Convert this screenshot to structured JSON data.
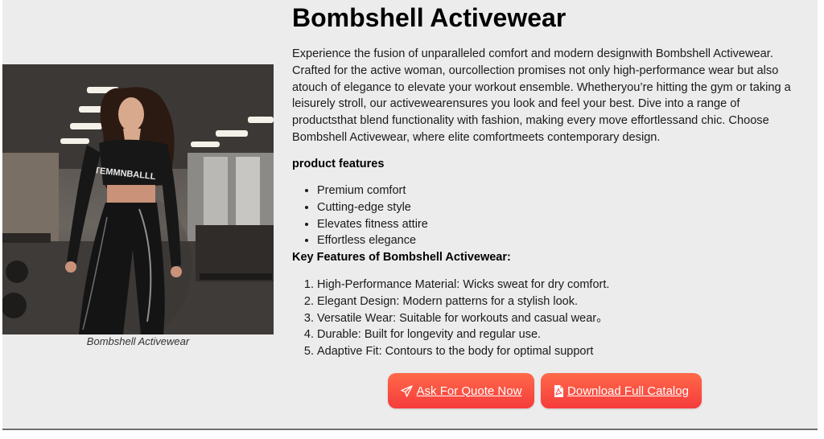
{
  "product": {
    "title": "Bombshell Activewear",
    "description": "Experience the fusion of unparalleled comfort and modern designwith Bombshell Activewear. Crafted for the active woman, ourcollection promises not only high-performance wear but also atouch of elegance to elevate your workout ensemble. Whetheryou’re hitting the gym or taking a leisurely stroll, our activewearensures you look and feel your best. Dive into a range of productsthat blend functionality with fashion, making every move effortlessand chic. Choose Bombshell Activewear, where elite comfortmeets contemporary design.",
    "image_caption": "Bombshell Activewear",
    "shirt_print": "TEMMNBALLL"
  },
  "features": {
    "heading": "product features",
    "items": [
      "Premium comfort",
      "Cutting-edge style",
      "Elevates fitness attire",
      "Effortless elegance"
    ]
  },
  "key_features": {
    "heading": "Key Features of Bombshell Activewear:",
    "items": [
      "High-Performance Material: Wicks sweat for dry comfort.",
      " Elegant Design: Modern patterns for a stylish look.",
      " Versatile Wear: Suitable for workouts and casual wear。",
      "Durable: Built for longevity and regular use.",
      "Adaptive Fit: Contours to the body for optimal support"
    ]
  },
  "actions": {
    "quote_label": "Ask For Quote Now",
    "quote_icon": "paper-plane-icon",
    "catalog_label": "Download Full Catalog",
    "catalog_icon": "pdf-file-icon"
  },
  "colors": {
    "button_gradient_top": "#ff6a4a",
    "button_gradient_bottom": "#f53b3b",
    "panel_background": "#ececec"
  }
}
